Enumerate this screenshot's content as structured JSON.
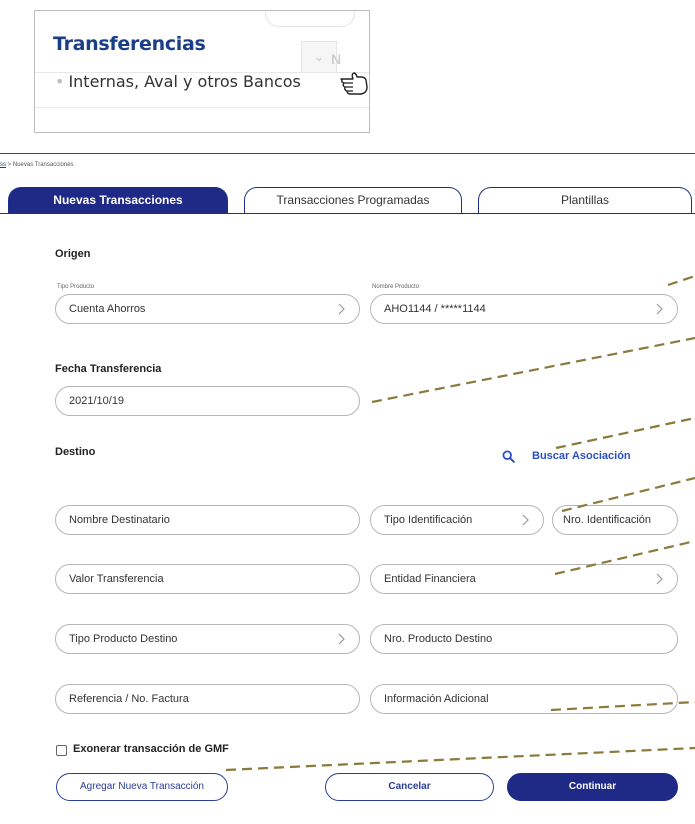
{
  "menu": {
    "title": "Transferencias",
    "item_bullet": "•",
    "item_label": "Internas, Aval y otros Bancos"
  },
  "breadcrumb": {
    "link": "ss",
    "separator": ">",
    "current": "Nuevas Transacciones"
  },
  "tabs": [
    {
      "label": "Nuevas Transacciones",
      "active": true
    },
    {
      "label": "Transacciones Programadas",
      "active": false
    },
    {
      "label": "Plantillas",
      "active": false
    }
  ],
  "form": {
    "origen": {
      "title": "Origen",
      "tipo_producto_label": "Tipo Producto",
      "tipo_producto_value": "Cuenta Ahorros",
      "nombre_producto_label": "Nombre Producto",
      "nombre_producto_value": "AHO1144 / *****1144"
    },
    "fecha": {
      "title": "Fecha Transferencia",
      "value": "2021/10/19"
    },
    "destino": {
      "title": "Destino",
      "search_link": "Buscar Asociación",
      "nombre_destinatario": "Nombre Destinatario",
      "tipo_identificacion": "Tipo Identificación",
      "nro_identificacion": "Nro. Identificación",
      "valor_transferencia": "Valor Transferencia",
      "entidad_financiera": "Entidad Financiera",
      "tipo_producto_destino": "Tipo Producto Destino",
      "nro_producto_destino": "Nro. Producto Destino",
      "referencia": "Referencia / No. Factura",
      "informacion_adicional": "Información Adicional"
    },
    "gmf_checkbox": {
      "label": "Exonerar transacción de GMF",
      "checked": false
    }
  },
  "actions": {
    "add": "Agregar Nueva Transacción",
    "cancel": "Cancelar",
    "continue": "Continuar"
  },
  "colors": {
    "brand_blue": "#1e2a86",
    "link_blue": "#2a4fc9",
    "callout": "#8a7a3c"
  },
  "icons": [
    "hand-pointer-icon",
    "chevron-right-icon",
    "search-icon"
  ]
}
